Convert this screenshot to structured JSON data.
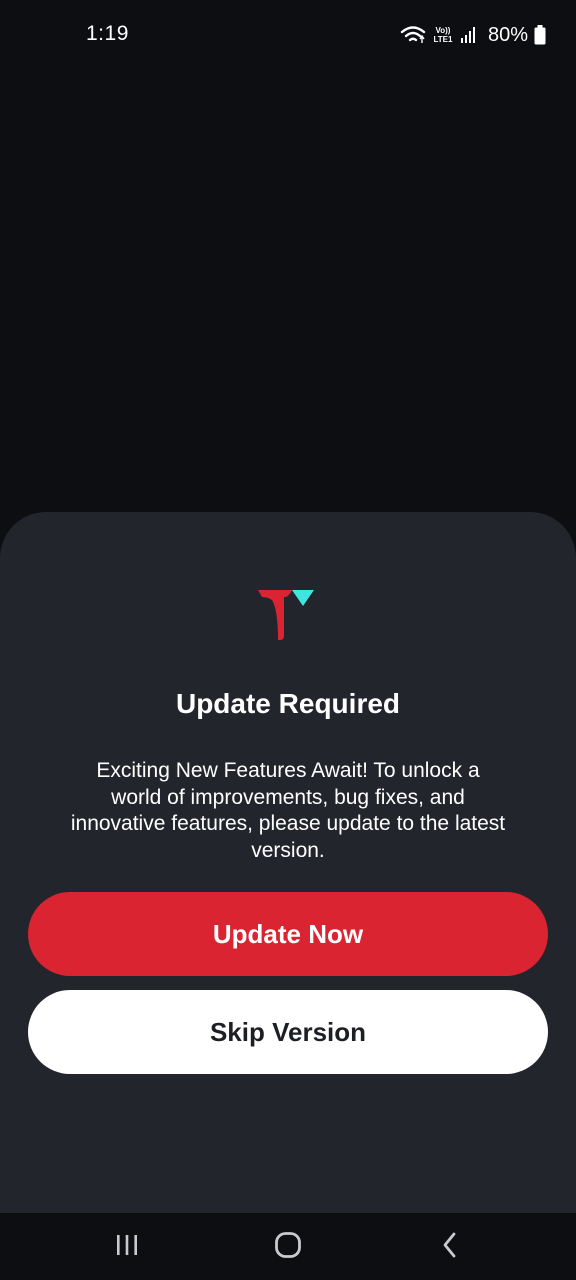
{
  "status_bar": {
    "time": "1:19",
    "network_top": "Vo))",
    "network_bottom": "LTE1",
    "battery_percent": "80%"
  },
  "dialog": {
    "title": "Update Required",
    "message": "Exciting New Features Await! To unlock a world of improvements, bug fixes, and innovative features, please update to the latest version.",
    "primary_button": "Update Now",
    "secondary_button": "Skip Version"
  },
  "colors": {
    "background": "#0d0e12",
    "sheet": "#23252c",
    "accent_red": "#da2432",
    "accent_cyan": "#3ee6e0",
    "secondary_button": "#ffffff"
  },
  "icons": {
    "status": [
      "wifi-icon",
      "signal-icon",
      "battery-icon"
    ],
    "logo": "app-logo-icon",
    "navigation": [
      "recents-icon",
      "home-icon",
      "back-icon"
    ]
  }
}
